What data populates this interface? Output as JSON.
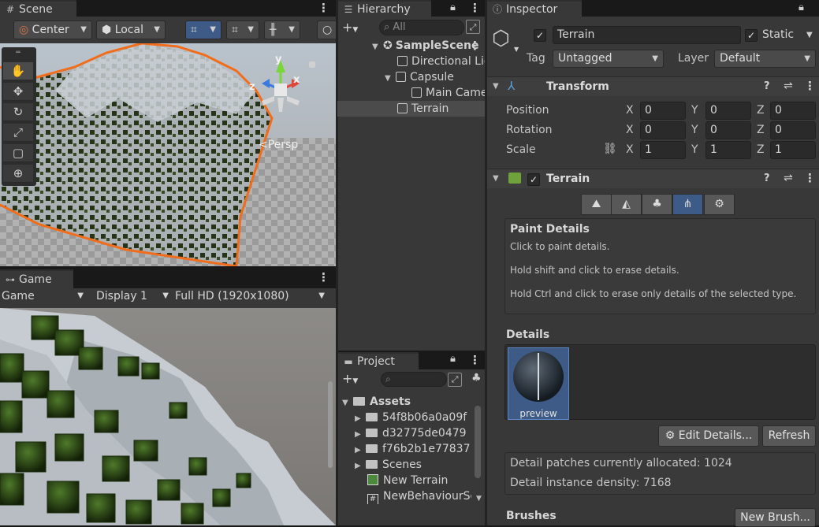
{
  "scene": {
    "tab_label": "Scene",
    "pivot_mode": "Center",
    "pivot_rotation": "Local",
    "persp_label": "Persp",
    "gizmo_axes": {
      "x": "x",
      "y": "y",
      "z": "z"
    }
  },
  "game": {
    "tab_label": "Game",
    "view_select": "Game",
    "display_select": "Display 1",
    "resolution_select": "Full HD (1920x1080)"
  },
  "hierarchy": {
    "tab_label": "Hierarchy",
    "search_placeholder": "All",
    "items": [
      {
        "label": "SampleScene"
      },
      {
        "label": "Directional Light"
      },
      {
        "label": "Capsule"
      },
      {
        "label": "Main Camera"
      },
      {
        "label": "Terrain"
      }
    ]
  },
  "project": {
    "tab_label": "Project",
    "assets_label": "Assets",
    "items": [
      {
        "label": "54f8b06a0a09f"
      },
      {
        "label": "d32775de0479"
      },
      {
        "label": "f76b2b1e77837"
      },
      {
        "label": "Scenes"
      },
      {
        "label": "New Terrain"
      },
      {
        "label": "NewBehaviourScript"
      }
    ]
  },
  "inspector": {
    "tab_label": "Inspector",
    "object_name": "Terrain",
    "static_label": "Static",
    "tag_label": "Tag",
    "tag_value": "Untagged",
    "layer_label": "Layer",
    "layer_value": "Default",
    "transform": {
      "title": "Transform",
      "position_label": "Position",
      "rotation_label": "Rotation",
      "scale_label": "Scale",
      "axis_x": "X",
      "axis_y": "Y",
      "axis_z": "Z",
      "position": {
        "x": "0",
        "y": "0",
        "z": "0"
      },
      "rotation": {
        "x": "0",
        "y": "0",
        "z": "0"
      },
      "scale": {
        "x": "1",
        "y": "1",
        "z": "1"
      }
    },
    "terrain": {
      "title": "Terrain",
      "help_title": "Paint Details",
      "help_line1": "Click to paint details.",
      "help_line2": "Hold shift and click to erase details.",
      "help_line3": "Hold Ctrl and click to erase only details of the selected type.",
      "details_label": "Details",
      "preview_label": "preview",
      "edit_details_button": "Edit Details...",
      "refresh_button": "Refresh",
      "patches_text": "Detail patches currently allocated: 1024",
      "density_text": "Detail instance density: 7168",
      "brushes_label": "Brushes",
      "new_brush_button": "New Brush..."
    }
  },
  "colors": {
    "selection_orange": "#f26d1b",
    "accent_blue": "#3d5b86",
    "panel_bg": "#383838"
  }
}
